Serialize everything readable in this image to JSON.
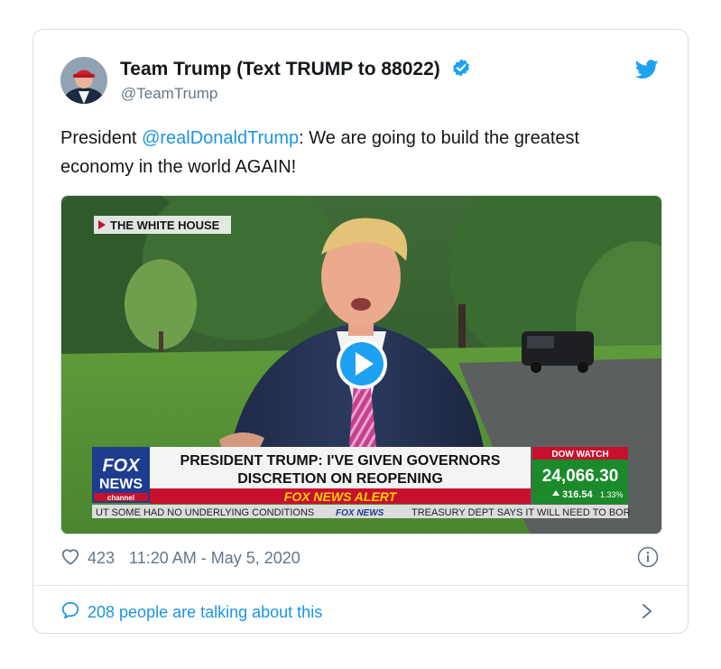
{
  "tweet": {
    "display_name": "Team Trump (Text TRUMP to 88022)",
    "handle": "@TeamTrump",
    "text_before": "President ",
    "mention": "@realDonaldTrump",
    "text_after": ": We are going to build the greatest economy in the world AGAIN!",
    "likes": "423",
    "timestamp": "11:20 AM - May 5, 2020",
    "conversation": "208 people are talking about this"
  },
  "video": {
    "location_tag": "THE WHITE HOUSE",
    "headline_line1": "PRESIDENT TRUMP: I'VE GIVEN GOVERNORS",
    "headline_line2": "DISCRETION ON REOPENING",
    "alert": "FOX NEWS ALERT",
    "logo_line1": "FOX",
    "logo_line2": "NEWS",
    "logo_line3": "channel",
    "dow_label": "DOW WATCH",
    "dow_value": "24,066.30",
    "dow_change": "316.54",
    "dow_pct": "1.33%",
    "ticker_left": "UT SOME HAD NO UNDERLYING CONDITIONS",
    "ticker_mid": "FOX NEWS",
    "ticker_right": "TREASURY DEPT SAYS IT WILL NEED TO BOR"
  },
  "colors": {
    "link": "#1b95e0",
    "muted": "#657786",
    "fox_red": "#c8102e",
    "fox_blue": "#1d3d8f",
    "dow_green": "#1a8a2a"
  },
  "icons": [
    "verified-badge-icon",
    "twitter-bird-icon",
    "play-icon",
    "heart-icon",
    "info-icon",
    "speech-bubble-icon",
    "chevron-right-icon"
  ]
}
